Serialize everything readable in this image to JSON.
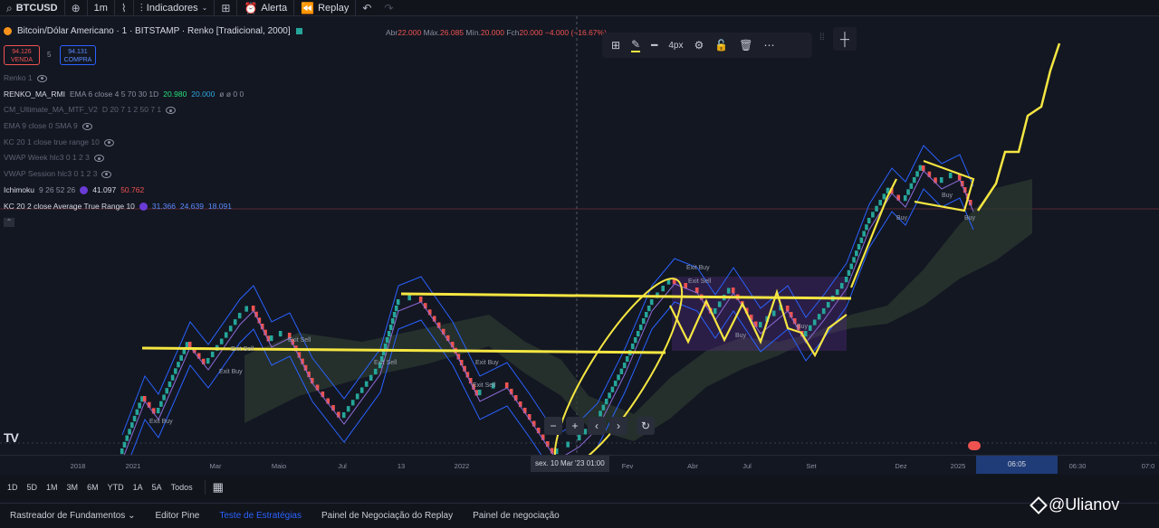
{
  "toolbar": {
    "symbol": "BTCUSD",
    "interval": "1m",
    "indicators_label": "Indicadores",
    "alert_label": "Alerta",
    "replay_label": "Replay"
  },
  "chart_header": {
    "title": "Bitcoin/Dólar Americano · 1 · BITSTAMP · Renko [Tradicional, 2000]",
    "ohlc": {
      "open": "22.000",
      "high": "26.085",
      "low": "20.000",
      "close": "20.000",
      "change": "−4.000 (−16.67%)"
    },
    "ohlc_labels": {
      "open": "Abr",
      "high": "Máx.",
      "low": "Mín.",
      "close": "Fch"
    },
    "sell_price": "94.126",
    "sell_label": "VENDA",
    "spread": "5",
    "buy_price": "94.131",
    "buy_label": "COMPRA"
  },
  "legend": [
    {
      "name": "Renko 1",
      "values": "",
      "dim": true
    },
    {
      "name": "RENKO_MA_RMI",
      "values": "EMA 6 close 4 5 70 30 1D",
      "v1": "20.980",
      "v2": "20.000",
      "tail": "ø ø 0 0",
      "dim": false
    },
    {
      "name": "CM_Ultimate_MA_MTF_V2",
      "values": "D 20 7 1 2 50 7 1",
      "dim": true
    },
    {
      "name": "EMA 9 close 0 SMA 9",
      "values": "",
      "dim": true
    },
    {
      "name": "KC 20 1 close true range 10",
      "values": "",
      "dim": true
    },
    {
      "name": "VWAP Week hlc3 0 1 2 3",
      "values": "",
      "dim": true
    },
    {
      "name": "VWAP Session hlc3 0 1 2 3",
      "values": "",
      "dim": true
    },
    {
      "name": "Ichimoku",
      "values": "9 26 52 26",
      "v1": "41.097",
      "v2": "50.762",
      "dim": false
    },
    {
      "name": "KC 20 2 close Average True Range 10",
      "values": "",
      "v1": "31.366",
      "v2": "24.639",
      "v3": "18.091",
      "dim": false
    }
  ],
  "drawing_toolbar": {
    "width_label": "4px"
  },
  "time_axis": {
    "ticks": [
      "2018",
      "2021",
      "Mar",
      "Maio",
      "Jul",
      "13",
      "2022",
      "Fev",
      "Abr",
      "Jul",
      "Set",
      "Dez",
      "2025",
      "06:30",
      "07:0"
    ],
    "crosshair_label": "sex. 10 Mar '23   01:00",
    "current_time": "06:05"
  },
  "ranges": [
    "1D",
    "5D",
    "1M",
    "3M",
    "6M",
    "YTD",
    "1A",
    "5A",
    "Todos"
  ],
  "bottom_tabs": [
    "Rastreador de Fundamentos",
    "Editor Pine",
    "Teste de Estratégias",
    "Painel de Negociação do Replay",
    "Painel de negociação"
  ],
  "active_tab": "Teste de Estratégias",
  "chart_labels": [
    "Exit Sell",
    "Exit Buy",
    "Exit Sell",
    "Exit Sell",
    "Exit Buy",
    "Exit Sell",
    "Exit Buy",
    "Buy",
    "Buy",
    "Exit Buy",
    "Exit Sell",
    "Buy",
    "Buy",
    "Buy"
  ],
  "watermark": "@Ulianov",
  "colors": {
    "up": "#26a69a",
    "down": "#ef5350",
    "annotation": "#f5e642",
    "kc": "#2962ff",
    "cloud": "#3a4a3a"
  }
}
